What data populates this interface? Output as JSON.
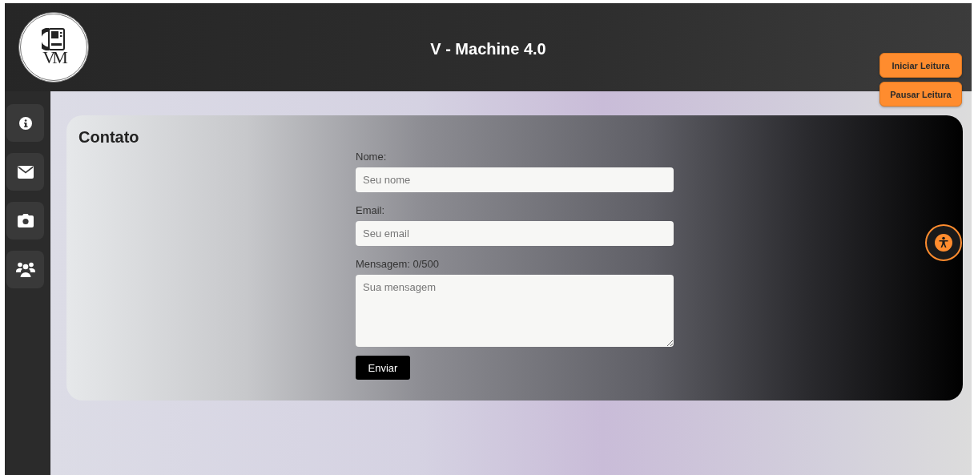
{
  "header": {
    "logo_text": "VM",
    "title": "V - Machine 4.0"
  },
  "reading_buttons": [
    "Iniciar Leitura",
    "Pausar Leitura"
  ],
  "sidebar": {
    "items": [
      {
        "kind": "info"
      },
      {
        "kind": "mail"
      },
      {
        "kind": "camera"
      },
      {
        "kind": "users"
      }
    ]
  },
  "contact": {
    "title": "Contato",
    "fields": [
      {
        "kind": "input",
        "label": "Nome:",
        "placeholder": "Seu nome"
      },
      {
        "kind": "input",
        "label": "Email:",
        "placeholder": "Seu email"
      },
      {
        "kind": "textarea",
        "label": "Mensagem: 0/500",
        "placeholder": "Sua mensagem"
      }
    ],
    "submit": "Enviar"
  }
}
